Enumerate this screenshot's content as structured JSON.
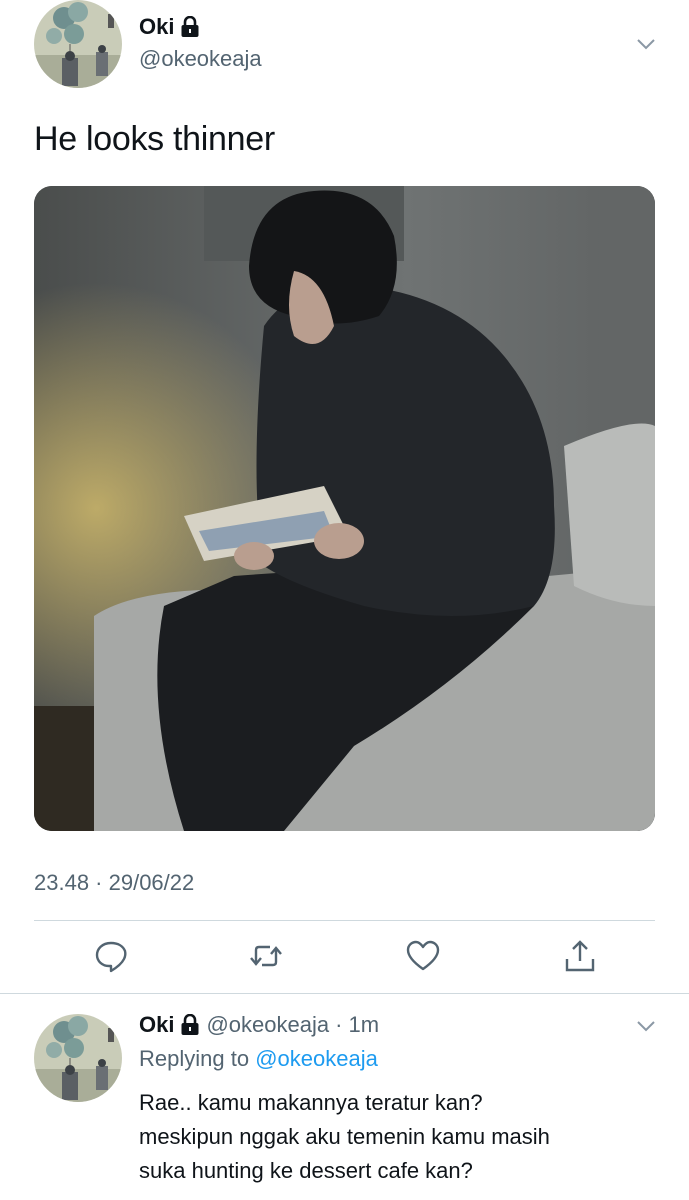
{
  "tweet": {
    "author": {
      "name": "Oki",
      "handle": "@okeokeaja",
      "protected": true
    },
    "text": "He looks thinner",
    "media": {
      "alt": ""
    },
    "timestamp": "23.48 · 29/06/22",
    "actions": [
      {
        "name": "reply",
        "icon": "reply-icon"
      },
      {
        "name": "retweet",
        "icon": "retweet-icon"
      },
      {
        "name": "like",
        "icon": "heart-icon"
      },
      {
        "name": "share",
        "icon": "share-icon"
      }
    ]
  },
  "reply": {
    "author": {
      "name": "Oki",
      "handle": "@okeokeaja",
      "time": "· 1m"
    },
    "replying_prefix": "Replying to",
    "replying_to": "@okeokeaja",
    "lines": [
      "Rae.. kamu makannya teratur kan?",
      "meskipun nggak aku temenin kamu masih",
      "suka hunting ke dessert cafe kan?"
    ]
  },
  "colors": {
    "text": "#0f1419",
    "secondary": "#536471",
    "accent": "#1d9bf0",
    "divider": "#cfd9de"
  }
}
